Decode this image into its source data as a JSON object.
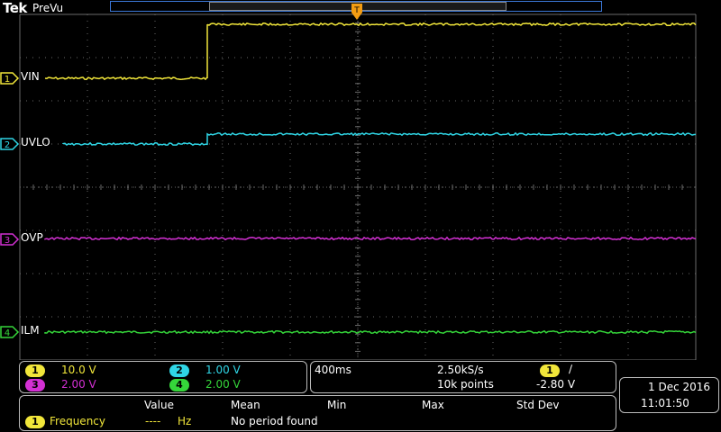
{
  "header": {
    "brand": "Tek",
    "status": "PreVu",
    "trigger_marker": "T"
  },
  "colors": {
    "ch1": "#f1e63a",
    "ch2": "#2fd6e6",
    "ch3": "#d330d3",
    "ch4": "#35d63a",
    "grid": "#6a6a6a",
    "record_bar": "#3c78d8",
    "trigger": "#f39c12"
  },
  "channels": [
    {
      "num": "1",
      "label": "VIN"
    },
    {
      "num": "2",
      "label": "UVLO"
    },
    {
      "num": "3",
      "label": "OVP"
    },
    {
      "num": "4",
      "label": "ILM"
    }
  ],
  "channel_settings": [
    {
      "num": "1",
      "scale": "10.0 V"
    },
    {
      "num": "2",
      "scale": "1.00 V"
    },
    {
      "num": "3",
      "scale": "2.00 V"
    },
    {
      "num": "4",
      "scale": "2.00 V"
    }
  ],
  "timebase": {
    "horizontal": "400ms",
    "sample_rate": "2.50kS/s",
    "record_length": "10k points",
    "trigger_source": "1",
    "trigger_slope": "∕",
    "trigger_level": "-2.80 V"
  },
  "datetime": {
    "date": "1 Dec  2016",
    "time": "11:01:50"
  },
  "measurements": {
    "headers": [
      "Value",
      "Mean",
      "Min",
      "Max",
      "Std Dev"
    ],
    "rows": [
      {
        "source": "1",
        "name": "Frequency",
        "value": "----",
        "unit": "Hz",
        "mean": "No period found"
      }
    ]
  }
}
